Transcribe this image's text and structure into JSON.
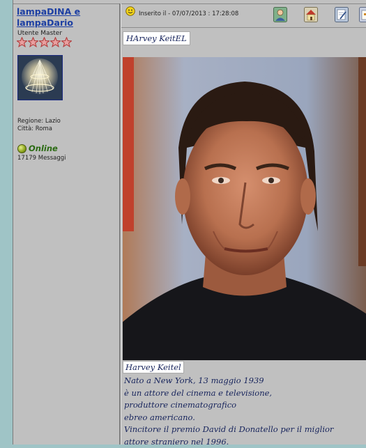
{
  "user": {
    "name": "lampaDINA e lampaDario",
    "rank": "Utente Master",
    "stars": 5,
    "region": "Regione: Lazio",
    "city": "Città: Roma",
    "status": "Online",
    "messages": "17179 Messaggi"
  },
  "post": {
    "posted": "Inserito il - 07/07/2013 : 17:28:08",
    "title": "HArvey KeitEL",
    "caption": "Harvey Keitel",
    "bio_lines": [
      "Nato a New York, 13 maggio 1939",
      "è un attore del cinema e televisione,",
      "produttore cinematografico",
      "ebreo americano.",
      "Vincitore il premio David di Donatello per il miglior",
      "attore straniero nel 1996."
    ]
  },
  "toolbar": {
    "icons": [
      "profile-icon",
      "home-icon",
      "edit-icon",
      "reply-quote-icon"
    ]
  },
  "colors": {
    "username": "#1d3fa3",
    "panel": "#c0c0c0",
    "outer": "#9fc4c6",
    "online": "#2a6a12",
    "post_text": "#17245c"
  }
}
